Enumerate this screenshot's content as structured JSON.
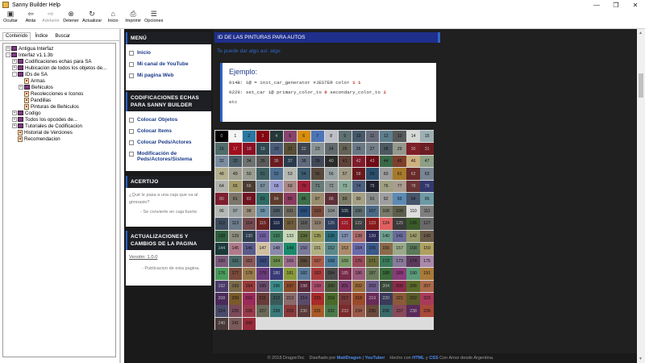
{
  "window": {
    "title": "Sanny Builder Help",
    "minimize": "—",
    "restore": "❐",
    "close": "✕"
  },
  "toolbar": [
    {
      "label": "Ocultar",
      "icon": "▣",
      "enabled": true
    },
    {
      "label": "Atrás",
      "icon": "⇦",
      "enabled": true
    },
    {
      "label": "Adelante",
      "icon": "⇨",
      "enabled": false
    },
    {
      "label": "Detener",
      "icon": "⊗",
      "enabled": true
    },
    {
      "label": "Actualizar",
      "icon": "↻",
      "enabled": true
    },
    {
      "label": "Inicio",
      "icon": "⌂",
      "enabled": true
    },
    {
      "label": "Imprimir",
      "icon": "⎙",
      "enabled": true
    },
    {
      "label": "Opciones",
      "icon": "☰",
      "enabled": true
    }
  ],
  "tabs": [
    "Contenido",
    "Índice",
    "Buscar"
  ],
  "tree": [
    {
      "label": "Antigua Interfaz",
      "level": 0,
      "type": "book",
      "exp": "+"
    },
    {
      "label": "Interfaz v1.1.3b",
      "level": 0,
      "type": "book",
      "exp": "-"
    },
    {
      "label": "Codificaciones echas para SA",
      "level": 1,
      "type": "book",
      "exp": "+"
    },
    {
      "label": "Hubicacion de todos los objetos de...",
      "level": 1,
      "type": "book",
      "exp": "+"
    },
    {
      "label": "IDs de SA",
      "level": 1,
      "type": "book",
      "exp": "-"
    },
    {
      "label": "Armas",
      "level": 2,
      "type": "page",
      "exp": ""
    },
    {
      "label": "Behiculos",
      "level": 2,
      "type": "book",
      "exp": "+"
    },
    {
      "label": "Recolecciones e Iconos",
      "level": 2,
      "type": "page",
      "exp": ""
    },
    {
      "label": "Pandillas",
      "level": 2,
      "type": "page",
      "exp": ""
    },
    {
      "label": "Pinturas de Behiculos",
      "level": 2,
      "type": "page",
      "exp": ""
    },
    {
      "label": "Codigo",
      "level": 1,
      "type": "book",
      "exp": "+"
    },
    {
      "label": "Todos los opcodes de...",
      "level": 1,
      "type": "book",
      "exp": "+"
    },
    {
      "label": "Tutoriales de Codificacion",
      "level": 1,
      "type": "book",
      "exp": "+"
    },
    {
      "label": "Historial de Verciones",
      "level": 1,
      "type": "page",
      "exp": ""
    },
    {
      "label": "Recomendacion",
      "level": 1,
      "type": "page",
      "exp": ""
    }
  ],
  "menu": {
    "title": "MENÚ",
    "items": [
      "Inicio",
      "Mi canal de YouTube",
      "Mi pagina Web"
    ]
  },
  "codif": {
    "title": "CODIFICACIONES ECHAS PARA SANNY BUILDER",
    "items": [
      "Colocar Objetos",
      "Colocar Items",
      "Colocar Peds/Actores",
      "Modificación de Peds/Actores/Sistema"
    ]
  },
  "acertijo": {
    "title": "ACERTIJO",
    "question": "¿Qué le pasa a una caja que va al gimnasio?",
    "answer": "- Se convierte en caja fuerte."
  },
  "updates": {
    "title": "ACTUALIZACIONES Y CAMBIOS DE LA PAGINA",
    "version": "Versión: 1.0.0",
    "note": "- Publicacion de esta pagina."
  },
  "main": {
    "header": "ID DE LAS PINTURAS PARA AUTOS",
    "subtitle": "Te puede dar algo así: algo:",
    "example_title": "Ejemplo:",
    "line1_a": "014B: 1@ = init_car_generator #JESTER color ",
    "line1_v1": "1",
    "line1_v2": "1",
    "line2_a": "0229: set_car 1@ primary_color_to ",
    "line2_v1": "0",
    "line2_b": " secondary_color_to ",
    "line2_v2": "1",
    "line3": "etc"
  },
  "palette": [
    "#000000",
    "#f5f5f5",
    "#2a77a1",
    "#840410",
    "#263739",
    "#86446e",
    "#d78e10",
    "#4c75b7",
    "#bdbec6",
    "#5e7072",
    "#46596a",
    "#656a79",
    "#5d7e8d",
    "#58595a",
    "#d6dad6",
    "#9cafb3",
    "#4f6c6b",
    "#a00f1e",
    "#8b0f23",
    "#2f4850",
    "#4a5b7a",
    "#594f36",
    "#3e4550",
    "#8a9494",
    "#636a6d",
    "#656356",
    "#6a7885",
    "#737f89",
    "#4d5962",
    "#95998d",
    "#7f1f27",
    "#6a1d23",
    "#7a8ca0",
    "#4b5e69",
    "#6e7371",
    "#5a5a5a",
    "#6b1c20",
    "#2a3d4e",
    "#5f6a7c",
    "#414959",
    "#2a2b2b",
    "#5e4137",
    "#801c2a",
    "#6e0c17",
    "#3a6947",
    "#7e3f2c",
    "#cdb180",
    "#8da086",
    "#b3b08e",
    "#a09f90",
    "#999d91",
    "#3e5f62",
    "#4e6f91",
    "#b5b8b2",
    "#3c5b6f",
    "#58483c",
    "#98a2a2",
    "#a09a85",
    "#69191e",
    "#2b4d6d",
    "#9c9c9c",
    "#a67a2a",
    "#6a2b2a",
    "#788592",
    "#b2b1ab",
    "#a39b68",
    "#4b3b31",
    "#7a8d9c",
    "#9a9cd1",
    "#a88986",
    "#a2203a",
    "#697b77",
    "#8d9494",
    "#8aab99",
    "#4c5e7e",
    "#1d1f2e",
    "#9fa082",
    "#aa9e90",
    "#6a3333",
    "#32386d",
    "#7d1e2f",
    "#7b756a",
    "#701320",
    "#2e6a63",
    "#5e3b2c",
    "#8a3b5f",
    "#3e6e4a",
    "#9a8c6e",
    "#5e2f37",
    "#7c7b66",
    "#a59f84",
    "#888c8a",
    "#9e9e9e",
    "#5c8bb3",
    "#47556b",
    "#6d9aa5",
    "#b4b9b5",
    "#9ba2a4",
    "#9a8d7c",
    "#6a8fa5",
    "#4f5c66",
    "#6f6a5d",
    "#2a4d7a",
    "#7a4a3a",
    "#8a8e8e",
    "#1f2b3c",
    "#5b6d6f",
    "#4a6a87",
    "#7a7a6a",
    "#5e5e4c",
    "#dedede",
    "#7e7e7e",
    "#3e4e5e",
    "#6c7b8b",
    "#734a4f",
    "#6a2323",
    "#1f2a45",
    "#6f5c3c",
    "#5f5f5f",
    "#8f7f6f",
    "#2e3e5e",
    "#9e1a2a",
    "#3e3e3e",
    "#8a1a1a",
    "#e06060",
    "#3a3a3a",
    "#3a5a2a",
    "#6a6a6a",
    "#2e5f3e",
    "#8e8e7e",
    "#2e3e4e",
    "#6e5e9e",
    "#3f7f5f",
    "#c6d6b6",
    "#5e6e3e",
    "#9e9e5e",
    "#2a6a7a",
    "#7e8eae",
    "#aa6a6a",
    "#2a2a5a",
    "#6e9e8e",
    "#6a6a9a",
    "#9a9a6a",
    "#6a5a4a",
    "#1a3a3a",
    "#b07a8a",
    "#5a5a8a",
    "#d0c0a0",
    "#8a8aaa",
    "#1a8a6a",
    "#7a7a9a",
    "#b0b080",
    "#5a8a8a",
    "#aa8a6a",
    "#6a6aaa",
    "#3a5a8a",
    "#8a6a4a",
    "#9aaa8a",
    "#5a7a5a",
    "#b0a060",
    "#7a5a7a",
    "#4a6a6a",
    "#8a5a5a",
    "#3a4a7a",
    "#6a8a4a",
    "#9a6a8a",
    "#5a4a3a",
    "#aa5a4a",
    "#4a7a9a",
    "#7a9a6a",
    "#9a4a5a",
    "#6a6a3a",
    "#3a7a5a",
    "#8a7a9a",
    "#5a3a5a",
    "#aa8aaa",
    "#4a9a5a",
    "#7a4a3a",
    "#9a7a4a",
    "#6a3a7a",
    "#3a3a7a",
    "#8a9a3a",
    "#5a7a9a",
    "#aa3a3a",
    "#4a4a4a",
    "#7a2a4a",
    "#9a5a7a",
    "#6a7a5a",
    "#3a6a3a",
    "#8a3a7a",
    "#5a9a7a",
    "#aa7a3a",
    "#4a3a6a",
    "#7a6a4a",
    "#9a3a3a",
    "#6a4a6a",
    "#3a8a8a",
    "#8a4a2a",
    "#5a2a3a",
    "#aa4a6a",
    "#4a5a3a",
    "#7a3a6a",
    "#9a6a3a",
    "#6a5a8a",
    "#3a4a3a",
    "#8a2a4a",
    "#5a6a2a",
    "#aa6a4a",
    "#4a2a5a",
    "#7a5a2a",
    "#9a2a5a",
    "#6a3a3a",
    "#3a5a5a",
    "#8a6a6a",
    "#5a4a6a",
    "#aa2a2a",
    "#4a6a2a",
    "#7a3a3a",
    "#9a4a2a",
    "#6a2a5a",
    "#3a3a5a",
    "#8a5a3a",
    "#5a5a2a",
    "#aa3a5a",
    "#4a4a6a",
    "#7a4a5a",
    "#9a3a4a",
    "#6a6a5a",
    "#3a7a7a",
    "#8a3a3a",
    "#5a3a3a",
    "#aa5a2a",
    "#4a7a4a",
    "#7a2a2a",
    "#9a5a4a",
    "#6a4a3a",
    "#3a6a6a",
    "#8a4a5a",
    "#5a2a5a",
    "#aa4a3a",
    "#4a3a3a",
    "#7a5a5a",
    "#9a2a3a"
  ]
}
